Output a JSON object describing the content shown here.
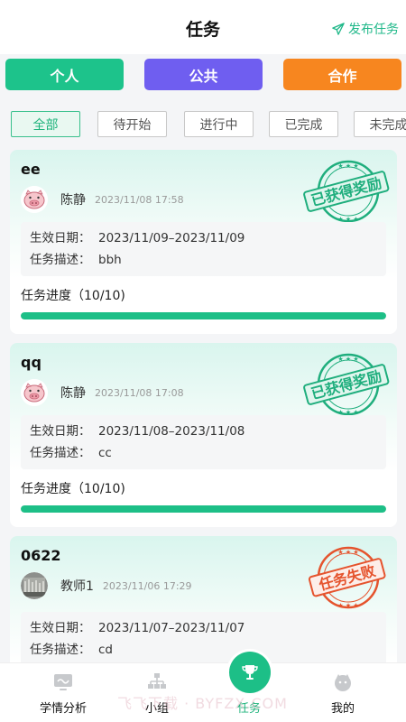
{
  "header": {
    "title": "任务",
    "publish_label": "发布任务"
  },
  "categories": {
    "personal": "个人",
    "public": "公共",
    "cooperation": "合作"
  },
  "filters": [
    "全部",
    "待开始",
    "进行中",
    "已完成",
    "未完成"
  ],
  "tasks": [
    {
      "name": "ee",
      "user": "陈静",
      "time": "2023/11/08 17:58",
      "date_label": "生效日期：",
      "date_value": "2023/11/09–2023/11/09",
      "desc_label": "任务描述：",
      "desc_value": "bbh",
      "progress_label": "任务进度（10/10)",
      "progress": 1.0,
      "stamp": "已获得奖励",
      "stamp_color": "#1fae7d",
      "avatar": "pig-avatar-icon"
    },
    {
      "name": "qq",
      "user": "陈静",
      "time": "2023/11/08 17:08",
      "date_label": "生效日期：",
      "date_value": "2023/11/08–2023/11/08",
      "desc_label": "任务描述：",
      "desc_value": "cc",
      "progress_label": "任务进度（10/10)",
      "progress": 1.0,
      "stamp": "已获得奖励",
      "stamp_color": "#1fae7d",
      "avatar": "pig-avatar-icon"
    },
    {
      "name": "0622",
      "user": "教师1",
      "time": "2023/11/06 17:29",
      "date_label": "生效日期：",
      "date_value": "2023/11/07–2023/11/07",
      "desc_label": "任务描述：",
      "desc_value": "cd",
      "stamp": "任务失败",
      "stamp_color": "#e5532d",
      "avatar": "photo-avatar-icon"
    }
  ],
  "bottom_nav": [
    "学情分析",
    "小组",
    "任务",
    "我的"
  ],
  "watermark": "飞飞下载 · BYFZX.COM",
  "colors": {
    "accent": "#1dbf87",
    "public": "#6f5ef0",
    "cooperation": "#f7861f"
  }
}
